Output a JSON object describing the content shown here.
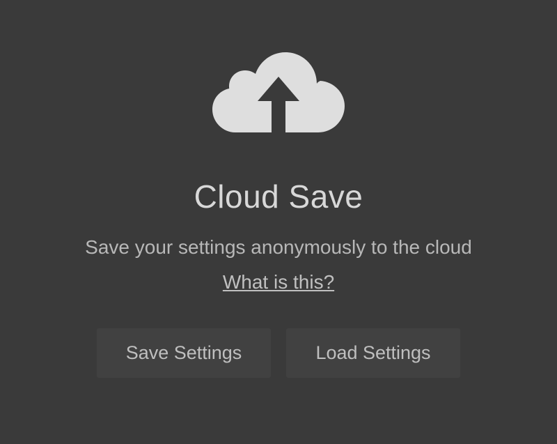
{
  "title": "Cloud Save",
  "subtitle": "Save your settings anonymously to the cloud",
  "help_link": "What is this?",
  "buttons": {
    "save": "Save Settings",
    "load": "Load Settings"
  },
  "icon": "cloud-upload",
  "colors": {
    "background": "#3a3a3a",
    "text": "#c8c8c8",
    "icon_fill": "#dedede"
  }
}
